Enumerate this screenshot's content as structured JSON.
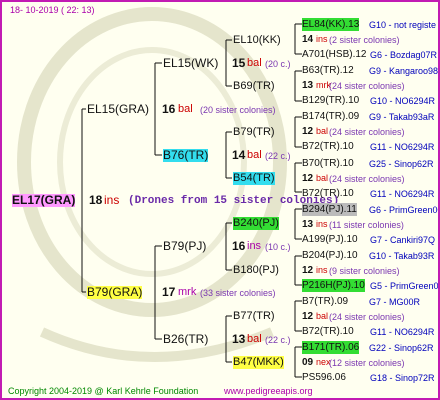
{
  "header": {
    "date": "18- 10-2019 ( 22: 13)"
  },
  "footer": {
    "copyright": "Copyright 2004-2019 @ Karl Kehrle Foundation",
    "site": "www.pedigreeapis.org"
  },
  "colors": {
    "pink": "#ff99ff",
    "yellow": "#ffff44",
    "cyan": "#33ddee",
    "green": "#33dd33",
    "gray": "#bbbbbb",
    "red": "#cc0000",
    "magenta": "#aa00aa",
    "blue": "#0000bb",
    "frame": "#c21bb3"
  },
  "root": {
    "name": "EL17(GRA)",
    "gen_count": "18",
    "gen_unit": "ins",
    "note": "(Drones from 15 sister colonies)"
  },
  "gen2": [
    {
      "name": "EL15(GRA)",
      "count": "16",
      "unit": "bal",
      "note": "(20 sister colonies)"
    },
    {
      "name": "B79(GRA)",
      "count": "17",
      "unit": "mrk",
      "note": "(33 sister colonies)"
    }
  ],
  "gen3": [
    {
      "name": "EL15(WK)",
      "count": "15",
      "unit": "bal",
      "note": "(20 c.)"
    },
    {
      "name": "B76(TR)",
      "count": "14",
      "unit": "bal",
      "note": "(22 c.)"
    },
    {
      "name": "B79(PJ)",
      "count": "16",
      "unit": "ins",
      "note": "(10 c.)"
    },
    {
      "name": "B26(TR)",
      "count": "13",
      "unit": "bal",
      "note": "(22 c.)"
    }
  ],
  "gen4": [
    "EL10(KK)",
    "B69(TR)",
    "B79(TR)",
    "B54(TR)",
    "B240(PJ)",
    "B180(PJ)",
    "B77(TR)",
    "B47(MKK)"
  ],
  "gen5": [
    {
      "dam": "EL84(KK).13",
      "damref": "G10 - not registe",
      "count": "14",
      "unit": "ins",
      "note": "(2 sister colonies)",
      "sire": "A701(HSB).12",
      "sireref": "G6 - Bozdag07R"
    },
    {
      "dam": "B63(TR).12",
      "damref": "G9 - Kangaroo98R",
      "count": "13",
      "unit": "mrk",
      "note": "(24 sister colonies)",
      "sire": "B129(TR).10",
      "sireref": "G10 - NO6294R"
    },
    {
      "dam": "B174(TR).09",
      "damref": "G9 - Takab93aR",
      "count": "12",
      "unit": "bal",
      "note": "(24 sister colonies)",
      "sire": "B72(TR).10",
      "sireref": "G11 - NO6294R"
    },
    {
      "dam": "B70(TR).10",
      "damref": "G25 - Sinop62R",
      "count": "12",
      "unit": "bal",
      "note": "(24 sister colonies)",
      "sire": "B72(TR).10",
      "sireref": "G11 - NO6294R"
    },
    {
      "dam": "B294(PJ).11",
      "damref": "G6 - PrimGreen00",
      "count": "13",
      "unit": "ins",
      "note": "(11 sister colonies)",
      "sire": "A199(PJ).10",
      "sireref": "G7 - Cankiri97Q"
    },
    {
      "dam": "B204(PJ).10",
      "damref": "G10 - Takab93R",
      "count": "12",
      "unit": "ins",
      "note": "(9 sister colonies)",
      "sire": "P216H(PJ).10",
      "sireref": "G5 - PrimGreen00"
    },
    {
      "dam": "B7(TR).09",
      "damref": "G7 - MG00R",
      "count": "12",
      "unit": "bal",
      "note": "(24 sister colonies)",
      "sire": "B72(TR).10",
      "sireref": "G11 - NO6294R"
    },
    {
      "dam": "B171(TR).06",
      "damref": "G22 - Sinop62R",
      "count": "09",
      "unit": "nex",
      "note": "(12 sister colonies)",
      "sire": "PS596.06",
      "sireref": "G18 - Sinop72R"
    }
  ]
}
